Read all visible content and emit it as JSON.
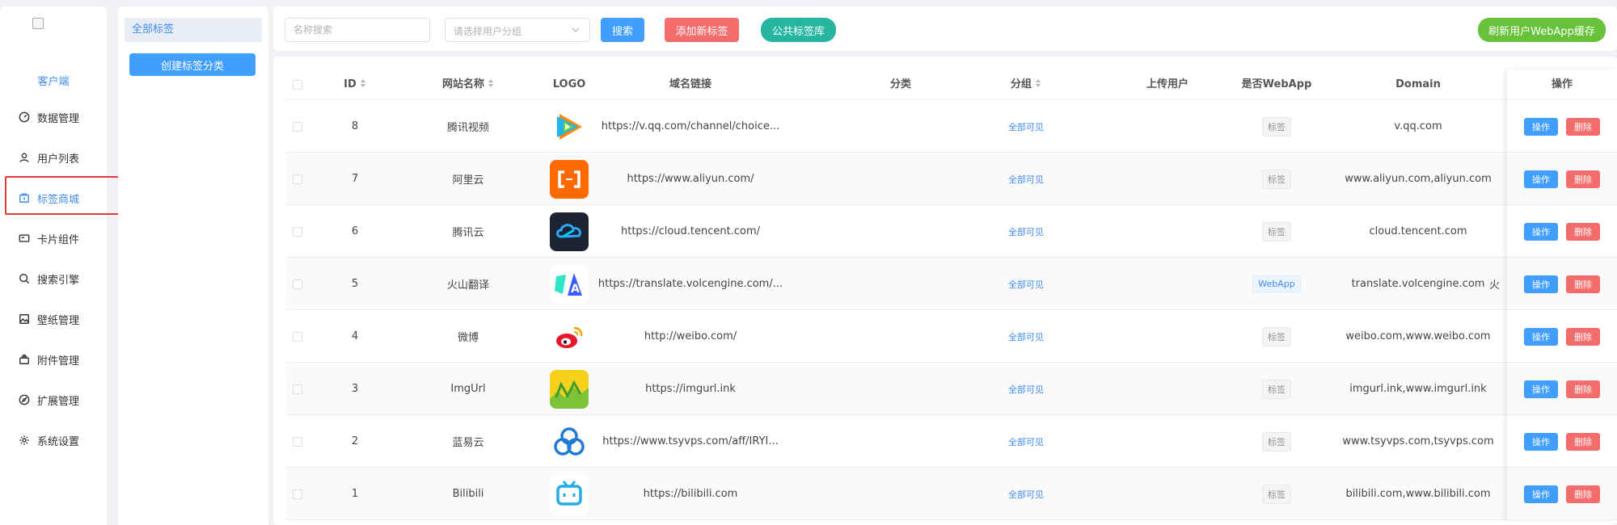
{
  "nav": {
    "brand": "客户端",
    "items": [
      {
        "label": "数据管理",
        "icon": "gauge-icon",
        "active": false
      },
      {
        "label": "用户列表",
        "icon": "user-icon",
        "active": false
      },
      {
        "label": "标签商城",
        "icon": "bag-icon",
        "active": true
      },
      {
        "label": "卡片组件",
        "icon": "card-icon",
        "active": false
      },
      {
        "label": "搜索引擎",
        "icon": "search-icon",
        "active": false
      },
      {
        "label": "壁纸管理",
        "icon": "image-icon",
        "active": false
      },
      {
        "label": "附件管理",
        "icon": "attachment-icon",
        "active": false
      },
      {
        "label": "扩展管理",
        "icon": "compass-icon",
        "active": false
      },
      {
        "label": "系统设置",
        "icon": "gear-icon",
        "active": false
      }
    ]
  },
  "categories": {
    "all_label": "全部标签",
    "create_label": "创建标签分类"
  },
  "toolbar": {
    "name_placeholder": "名称搜索",
    "group_placeholder": "请选择用户分组",
    "search_label": "搜索",
    "add_label": "添加新标签",
    "public_label": "公共标签库",
    "refresh_label": "刷新用户WebApp缓存"
  },
  "table": {
    "columns": [
      "ID",
      "网站名称",
      "LOGO",
      "域名链接",
      "分类",
      "分组",
      "上传用户",
      "是否WebApp",
      "Domain",
      "操作"
    ],
    "edit_label": "操作",
    "delete_label": "删除",
    "rows": [
      {
        "id": "8",
        "name": "腾讯视频",
        "logo": "tencent-video",
        "url": "https://v.qq.com/channel/choice...",
        "group": "全部可见",
        "webapp": "标签",
        "webapp_type": "grey",
        "domain": "v.qq.com",
        "extra": ""
      },
      {
        "id": "7",
        "name": "阿里云",
        "logo": "aliyun",
        "url": "https://www.aliyun.com/",
        "group": "全部可见",
        "webapp": "标签",
        "webapp_type": "grey",
        "domain": "www.aliyun.com,aliyun.com",
        "extra": ""
      },
      {
        "id": "6",
        "name": "腾讯云",
        "logo": "tencent-cloud",
        "url": "https://cloud.tencent.com/",
        "group": "全部可见",
        "webapp": "标签",
        "webapp_type": "grey",
        "domain": "cloud.tencent.com",
        "extra": ""
      },
      {
        "id": "5",
        "name": "火山翻译",
        "logo": "volc-translate",
        "url": "https://translate.volcengine.com/...",
        "group": "全部可见",
        "webapp": "WebApp",
        "webapp_type": "blue",
        "domain": "translate.volcengine.com",
        "extra": "火"
      },
      {
        "id": "4",
        "name": "微博",
        "logo": "weibo",
        "url": "http://weibo.com/",
        "group": "全部可见",
        "webapp": "标签",
        "webapp_type": "grey",
        "domain": "weibo.com,www.weibo.com",
        "extra": ""
      },
      {
        "id": "3",
        "name": "ImgUrl",
        "logo": "imgurl",
        "url": "https://imgurl.ink",
        "group": "全部可见",
        "webapp": "标签",
        "webapp_type": "grey",
        "domain": "imgurl.ink,www.imgurl.ink",
        "extra": ""
      },
      {
        "id": "2",
        "name": "蓝易云",
        "logo": "tsyvps",
        "url": "https://www.tsyvps.com/aff/IRYI...",
        "group": "全部可见",
        "webapp": "标签",
        "webapp_type": "grey",
        "domain": "www.tsyvps.com,tsyvps.com",
        "extra": ""
      },
      {
        "id": "1",
        "name": "Bilibili",
        "logo": "bilibili",
        "url": "https://bilibili.com",
        "group": "全部可见",
        "webapp": "标签",
        "webapp_type": "grey",
        "domain": "bilibili.com,www.bilibili.com",
        "extra": ""
      }
    ]
  },
  "colors": {
    "primary": "#409eff",
    "danger": "#f56c6c",
    "teal": "#26b5a0",
    "success": "#67c23a",
    "highlight_box": "#e53935"
  }
}
